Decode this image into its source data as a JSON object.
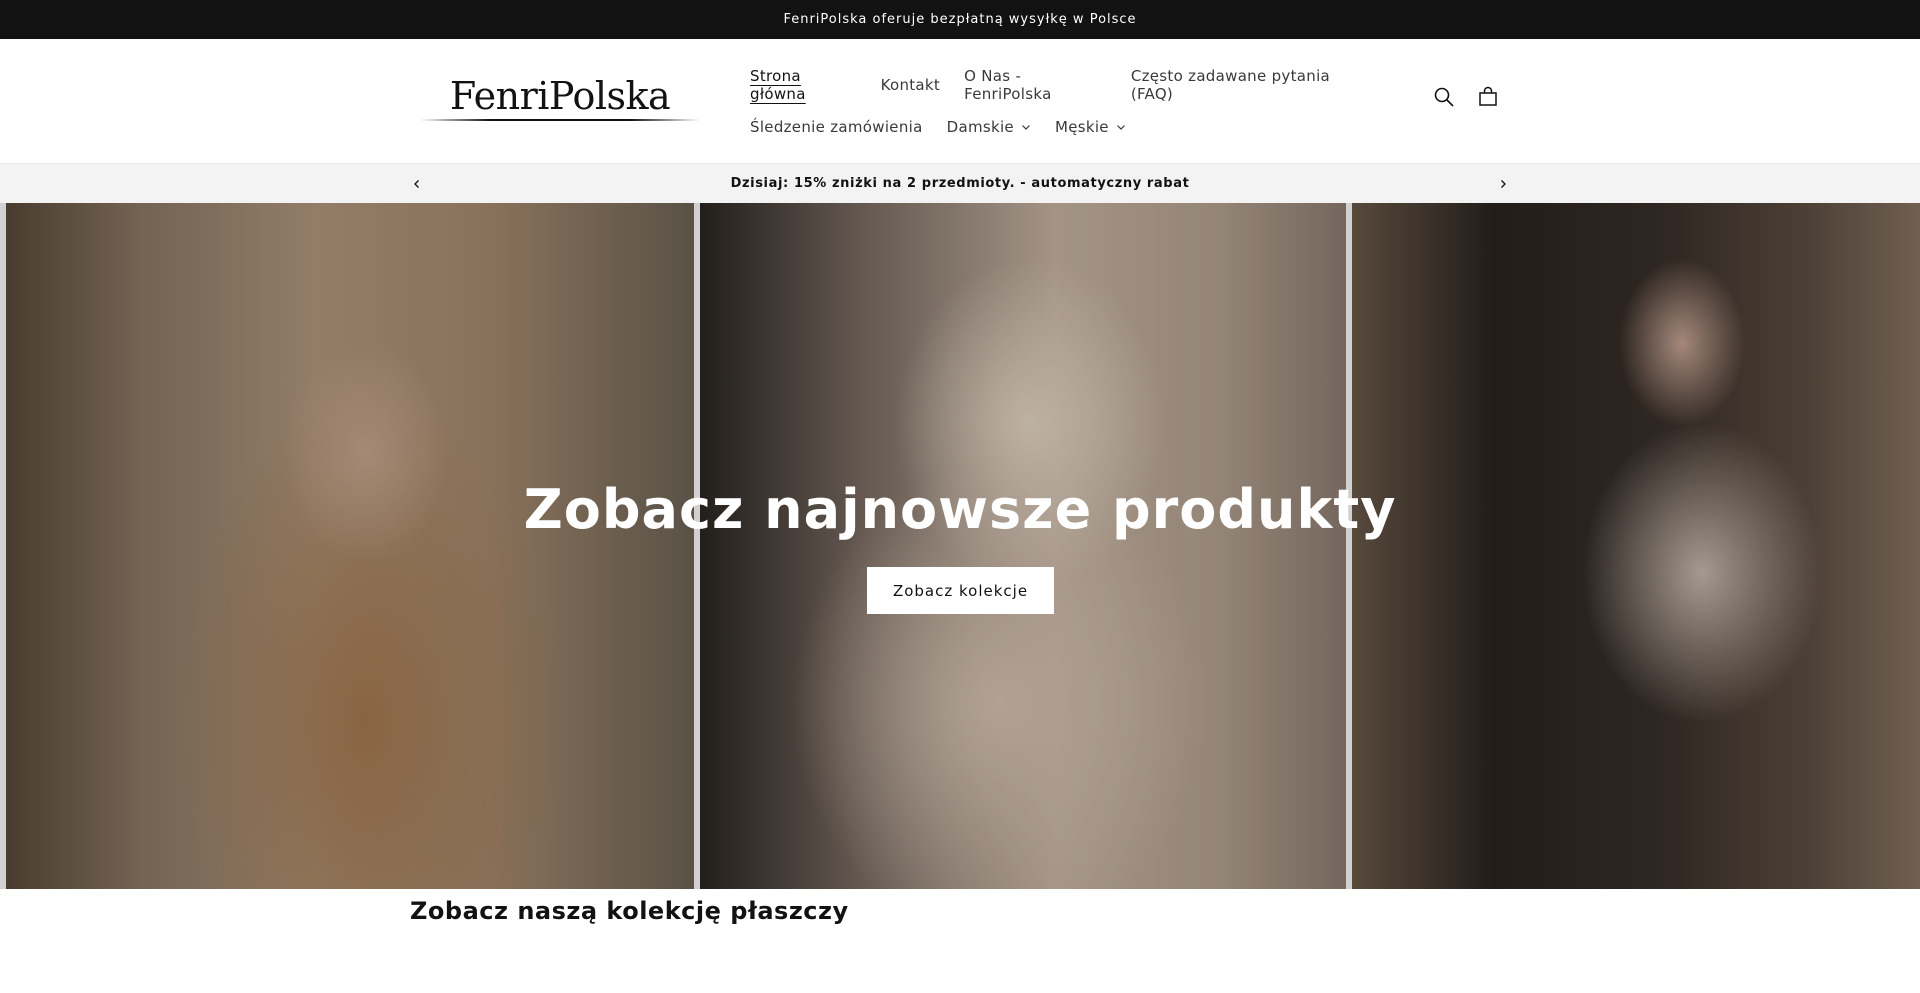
{
  "topbar": {
    "text": "FenriPolska oferuje bezpłatną wysyłkę w Polsce"
  },
  "header": {
    "logo_text": "FenriPolska",
    "nav_row1": [
      {
        "label": "Strona główna",
        "active": true
      },
      {
        "label": "Kontakt"
      },
      {
        "label": "O Nas - FenriPolska"
      },
      {
        "label": "Często zadawane pytania (FAQ)"
      }
    ],
    "nav_row2": [
      {
        "label": "Śledzenie zamówienia"
      },
      {
        "label": "Damskie",
        "dropdown": true
      },
      {
        "label": "Męskie",
        "dropdown": true
      }
    ],
    "icons": [
      "search-icon",
      "cart-icon"
    ]
  },
  "announcement": {
    "text": "Dzisiaj: 15% zniżki na 2 przedmioty. - automatyczny rabat",
    "prev_icon": "chevron-left-icon",
    "next_icon": "chevron-right-icon"
  },
  "hero": {
    "title": "Zobacz najnowsze produkty",
    "button_label": "Zobacz kolekcje"
  },
  "section": {
    "title": "Zobacz naszą kolekcję płaszczy"
  },
  "colors": {
    "topbar_bg": "#121212",
    "announce_bg": "#f3f3f3",
    "text": "#121212"
  }
}
